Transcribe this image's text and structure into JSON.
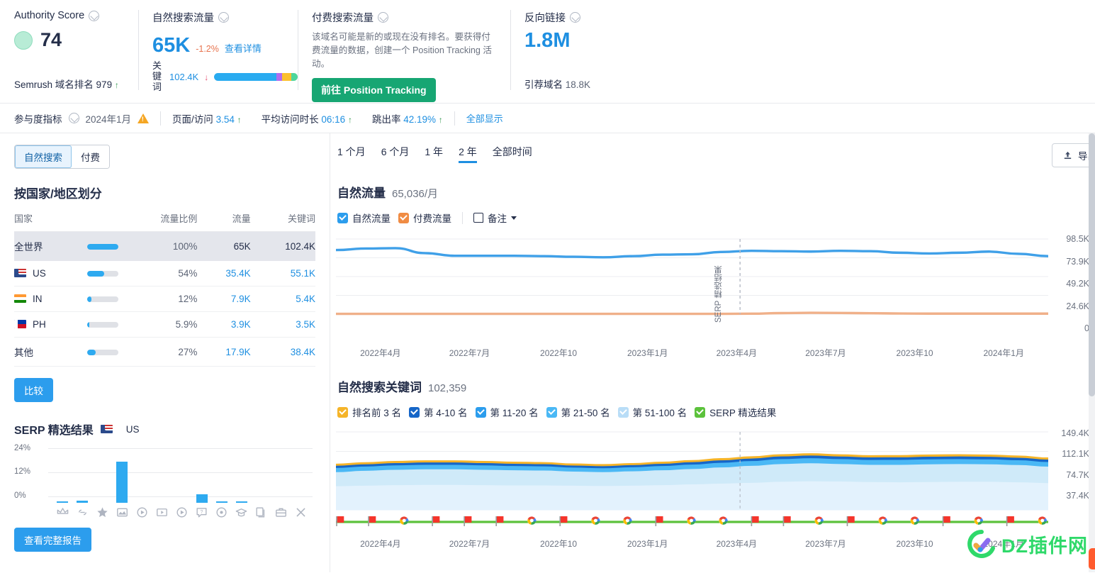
{
  "metrics": {
    "authority": {
      "title": "Authority Score",
      "value": "74",
      "footer_label": "Semrush 域名排名",
      "footer_value": "979",
      "footer_trend": "↑"
    },
    "organic": {
      "title": "自然搜索流量",
      "value": "65K",
      "delta": "-1.2%",
      "link": "查看详情",
      "kw_label": "关键词",
      "kw_value": "102.4K",
      "kw_trend": "↓",
      "bar_segments": [
        {
          "color": "#29abf0",
          "pct": 74
        },
        {
          "color": "#b06cf0",
          "pct": 7
        },
        {
          "color": "#fcc02e",
          "pct": 11
        },
        {
          "color": "#4dd69c",
          "pct": 8
        }
      ]
    },
    "paid": {
      "title": "付费搜索流量",
      "description": "该域名可能是新的或现在没有排名。要获得付费流量的数据，创建一个 Position Tracking 活动。",
      "button": "前往 Position Tracking"
    },
    "backlinks": {
      "title": "反向链接",
      "value": "1.8M",
      "footer_label": "引荐域名",
      "footer_value": "18.8K"
    }
  },
  "engagement": {
    "label": "参与度指标",
    "date": "2024年1月",
    "items": [
      {
        "label": "页面/访问",
        "value": "3.54",
        "trend": "↑"
      },
      {
        "label": "平均访问时长",
        "value": "06:16",
        "trend": "↑"
      },
      {
        "label": "跳出率",
        "value": "42.19%",
        "trend": "↑"
      }
    ],
    "show_all": "全部显示"
  },
  "left_panel": {
    "segments": [
      {
        "label": "自然搜索",
        "active": true
      },
      {
        "label": "付费",
        "active": false
      }
    ],
    "section_title": "按国家/地区划分",
    "columns": [
      "国家",
      "流量比例",
      "流量",
      "关键词"
    ],
    "rows": [
      {
        "country": "全世界",
        "flag": "",
        "bar": 100,
        "share": "100%",
        "traffic": "65K",
        "keywords": "102.4K",
        "highlight": true
      },
      {
        "country": "US",
        "flag": "us",
        "bar": 54,
        "share": "54%",
        "traffic": "35.4K",
        "keywords": "55.1K",
        "highlight": false
      },
      {
        "country": "IN",
        "flag": "in",
        "bar": 12,
        "share": "12%",
        "traffic": "7.9K",
        "keywords": "5.4K",
        "highlight": false
      },
      {
        "country": "PH",
        "flag": "ph",
        "bar": 6,
        "share": "5.9%",
        "traffic": "3.9K",
        "keywords": "3.5K",
        "highlight": false
      },
      {
        "country": "其他",
        "flag": "",
        "bar": 27,
        "share": "27%",
        "traffic": "17.9K",
        "keywords": "38.4K",
        "highlight": false
      }
    ],
    "compare_button": "比较",
    "serp_title": "SERP 精选结果",
    "serp_country": "US",
    "serp_full_report": "查看完整报告"
  },
  "chart_data": [
    {
      "type": "line",
      "title": "自然流量",
      "subtitle": "65,036/月",
      "ylabel": "",
      "xlabel": "",
      "ylim": [
        0,
        98500
      ],
      "ytick_labels": [
        "98.5K",
        "73.9K",
        "49.2K",
        "24.6K",
        "0"
      ],
      "ytick_values": [
        98500,
        73900,
        49200,
        24600,
        0
      ],
      "x": [
        "2022年4月",
        "2022年7月",
        "2022年10",
        "2023年1月",
        "2023年4月",
        "2023年7月",
        "2023年10",
        "2024年1月"
      ],
      "grid": true,
      "legend_position": "top",
      "annotation": "SERP 精选结果",
      "series": [
        {
          "name": "自然流量",
          "color": "#3fa0e8",
          "values": [
            84000,
            86000,
            86500,
            80000,
            76500,
            76500,
            76500,
            76000,
            75200,
            74500,
            76000,
            78000,
            78500,
            81500,
            83000,
            82500,
            82000,
            83000,
            82500,
            80500,
            79500,
            80500,
            82000,
            79000,
            76000
          ]
        },
        {
          "name": "付费流量",
          "color": "#f0b089",
          "values": [
            400,
            400,
            400,
            400,
            400,
            400,
            400,
            400,
            400,
            400,
            400,
            400,
            400,
            400,
            600,
            1400,
            1800,
            1600,
            1200,
            900,
            700,
            700,
            700,
            700,
            700
          ]
        }
      ]
    },
    {
      "type": "area",
      "title": "自然搜索关键词",
      "subtitle": "102,359",
      "ylim": [
        0,
        149400
      ],
      "ytick_labels": [
        "149.4K",
        "112.1K",
        "74.7K",
        "37.4K"
      ],
      "ytick_values": [
        149400,
        112100,
        74700,
        37400
      ],
      "x": [
        "2022年4月",
        "2022年7月",
        "2022年10",
        "2023年1月",
        "2023年4月",
        "2023年7月",
        "2023年10",
        "2024年1月"
      ],
      "grid": true,
      "legend_position": "top",
      "stacked": true,
      "series": [
        {
          "name": "第 51-100 名",
          "color": "#e3f2fd",
          "values": [
            46000,
            47000,
            48000,
            48500,
            48500,
            48000,
            47500,
            47500,
            47000,
            46500,
            47000,
            48000,
            49500,
            51000,
            52500,
            54500,
            55500,
            55000,
            54000,
            53500,
            54000,
            54500,
            54500,
            53500,
            52000
          ]
        },
        {
          "name": "第 21-50 名",
          "color": "#cfeaf9",
          "values": [
            27000,
            28500,
            29500,
            30000,
            30000,
            29500,
            29000,
            28500,
            27000,
            26500,
            27500,
            28500,
            29500,
            31000,
            32500,
            34000,
            34500,
            33500,
            33000,
            33500,
            34000,
            34000,
            33500,
            33000,
            31500
          ]
        },
        {
          "name": "第 11-20 名",
          "color": "#4ab8f5",
          "values": [
            8000,
            8200,
            8400,
            8500,
            8500,
            8400,
            8200,
            8000,
            7600,
            7500,
            7800,
            8200,
            8500,
            8900,
            9200,
            9500,
            9700,
            9400,
            9300,
            9400,
            9500,
            9500,
            9400,
            9200,
            8800
          ]
        },
        {
          "name": "第 4-10 名",
          "color": "#1666c8",
          "values": [
            4200,
            4300,
            4400,
            4500,
            4500,
            4400,
            4300,
            4200,
            4000,
            3950,
            4100,
            4300,
            4500,
            4700,
            4850,
            5000,
            5100,
            4950,
            4900,
            4950,
            5000,
            5000,
            4950,
            4850,
            4650
          ]
        },
        {
          "name": "排名前 3 名",
          "color": "#f5b429",
          "values": [
            1700,
            1750,
            1800,
            1850,
            1850,
            1800,
            1780,
            1750,
            1650,
            1620,
            1680,
            1750,
            1820,
            1900,
            1960,
            2020,
            2060,
            2000,
            1980,
            2000,
            2020,
            2020,
            2000,
            1960,
            1880
          ]
        }
      ],
      "marker_line_color": "#5cc23c"
    }
  ],
  "chart_tabs": [
    {
      "label": "1 个月",
      "active": false
    },
    {
      "label": "6 个月",
      "active": false
    },
    {
      "label": "1 年",
      "active": false
    },
    {
      "label": "2 年",
      "active": true
    },
    {
      "label": "全部时间",
      "active": false
    }
  ],
  "export_button": "导出",
  "traffic_legend": [
    {
      "label": "自然流量",
      "color": "#2c9ded",
      "checked": true
    },
    {
      "label": "付费流量",
      "color": "#f08c44",
      "checked": true
    }
  ],
  "notes_label": "备注",
  "keyword_legend": [
    {
      "label": "排名前 3 名",
      "color": "#f5b429",
      "checked": true
    },
    {
      "label": "第 4-10 名",
      "color": "#1666c8",
      "checked": true
    },
    {
      "label": "第 11-20 名",
      "color": "#2c9ded",
      "checked": true
    },
    {
      "label": "第 21-50 名",
      "color": "#4ab8f5",
      "checked": true
    },
    {
      "label": "第 51-100 名",
      "color": "#b9ddf7",
      "checked": true
    },
    {
      "label": "SERP 精选结果",
      "color": "#5cc23c",
      "checked": true
    }
  ],
  "serp_features_chart": {
    "type": "bar",
    "ytick_labels": [
      "24%",
      "12%",
      "0%"
    ],
    "values": [
      0.8,
      1.0,
      0,
      19.5,
      0,
      0,
      0,
      4.0,
      0.8,
      0.7,
      0,
      0,
      0
    ],
    "ylim": [
      0,
      24
    ],
    "icons": [
      "crown-icon",
      "link-icon",
      "star-icon",
      "image-icon",
      "video-icon",
      "video-box-icon",
      "play-icon",
      "question-icon",
      "location-icon",
      "graduate-icon",
      "document-icon",
      "briefcase-icon",
      "x-icon"
    ]
  },
  "watermark": "DZ插件网"
}
